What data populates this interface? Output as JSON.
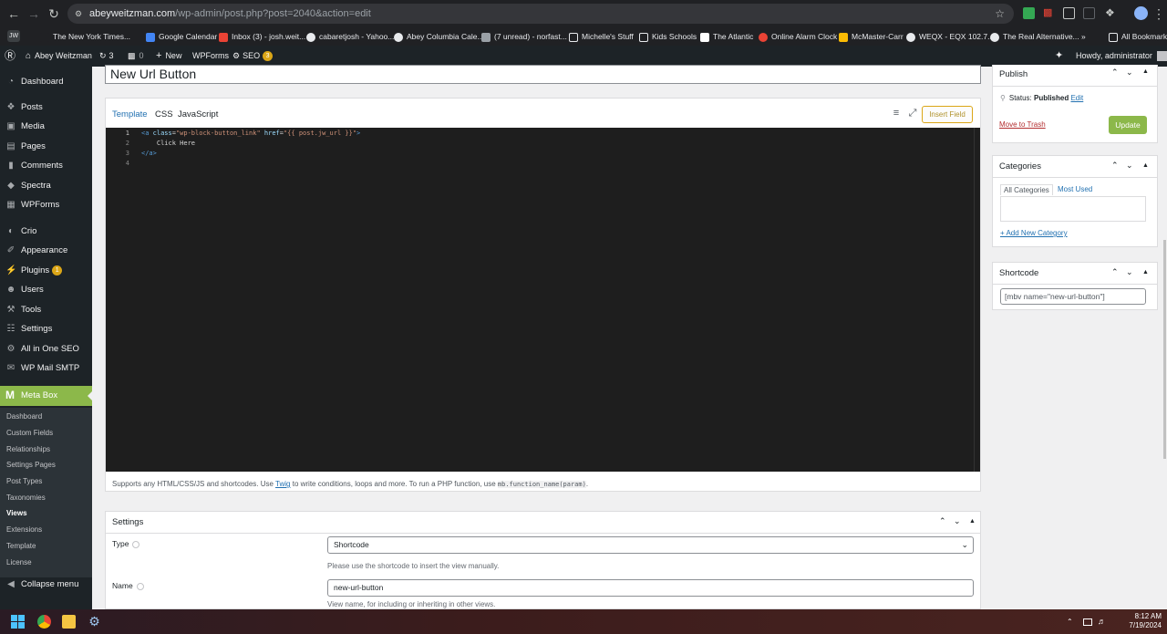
{
  "browser": {
    "url_host": "abeyweitzman.com",
    "url_path": "/wp-admin/post.php?post=2040&action=edit",
    "bookmarks": [
      "The New York Times...",
      "Google Calendar",
      "Inbox (3) - josh.weit...",
      "cabaretjosh - Yahoo...",
      "Abey Columbia Cale...",
      "(7 unread) - norfast...",
      "Michelle's Stuff",
      "Kids Schools",
      "The Atlantic",
      "Online Alarm Clock",
      "McMaster-Carr",
      "WEQX - EQX 102.7...",
      "The Real Alternative...",
      "All Bookmarks"
    ],
    "profile_label": "JW"
  },
  "adminbar": {
    "site_name": "Abey Weitzman",
    "updates_count": "3",
    "comments_count": "0",
    "new_label": "New",
    "wpforms_label": "WPForms",
    "seo_label": "SEO",
    "seo_count": "3",
    "howdy": "Howdy, administrator"
  },
  "sidebar": {
    "items": [
      {
        "label": "Dashboard",
        "icon": "dashboard-icon"
      },
      {
        "label": "Posts",
        "icon": "pin-icon"
      },
      {
        "label": "Media",
        "icon": "media-icon"
      },
      {
        "label": "Pages",
        "icon": "page-icon"
      },
      {
        "label": "Comments",
        "icon": "comment-icon"
      },
      {
        "label": "Spectra",
        "icon": "spectra-icon"
      },
      {
        "label": "WPForms",
        "icon": "wpforms-icon"
      },
      {
        "label": "Crio",
        "icon": "crio-icon"
      },
      {
        "label": "Appearance",
        "icon": "brush-icon"
      },
      {
        "label": "Plugins",
        "icon": "plugin-icon",
        "badge": "1"
      },
      {
        "label": "Users",
        "icon": "user-icon"
      },
      {
        "label": "Tools",
        "icon": "wrench-icon"
      },
      {
        "label": "Settings",
        "icon": "settings-icon"
      },
      {
        "label": "All in One SEO",
        "icon": "seo-icon"
      },
      {
        "label": "WP Mail SMTP",
        "icon": "mail-icon"
      }
    ],
    "metabox_label": "Meta Box",
    "submenu": [
      "Dashboard",
      "Custom Fields",
      "Relationships",
      "Settings Pages",
      "Post Types",
      "Taxonomies",
      "Views",
      "Extensions",
      "Template",
      "License"
    ],
    "collapse_label": "Collapse menu"
  },
  "editor": {
    "post_title": "New Url Button",
    "tabs": [
      "Template",
      "CSS",
      "JavaScript"
    ],
    "insert_field_label": "Insert Field",
    "line_numbers": [
      "1",
      "2",
      "3",
      "4"
    ],
    "code": {
      "line1_open": "<a",
      "line1_attr1": " class",
      "line1_eq1": "=",
      "line1_val1": "\"wp-block-button_link\"",
      "line1_attr2": " href",
      "line1_eq2": "=",
      "line1_val2": "\"{{ post.jw_url }}\"",
      "line1_close": ">",
      "line2": "    Click Here",
      "line3": "</a>"
    },
    "help_before": "Supports any HTML/CSS/JS and shortcodes. Use ",
    "help_link": "Twig",
    "help_middle": " to write conditions, loops and more. To run a PHP function, use ",
    "help_code": "mb.function_name(param)",
    "help_after": "."
  },
  "settings": {
    "title": "Settings",
    "type_label": "Type",
    "type_value": "Shortcode",
    "type_desc": "Please use the shortcode to insert the view manually.",
    "name_label": "Name",
    "name_value": "new-url-button",
    "name_desc": "View name, for including or inheriting in other views."
  },
  "publish": {
    "title": "Publish",
    "status_label": "Status:",
    "status_value": "Published",
    "edit_link": "Edit",
    "trash_link": "Move to Trash",
    "update_label": "Update"
  },
  "categories": {
    "title": "Categories",
    "tab_all": "All Categories",
    "tab_most": "Most Used",
    "add_link": "+ Add New Category"
  },
  "shortcode": {
    "title": "Shortcode",
    "value": "[mbv name=\"new-url-button\"]"
  },
  "taskbar": {
    "time": "8:12 AM",
    "date": "7/19/2024"
  },
  "colors": {
    "wp_admin_dark": "#1d2327",
    "metabox_green": "#8cb84a",
    "link_blue": "#2271b1"
  }
}
